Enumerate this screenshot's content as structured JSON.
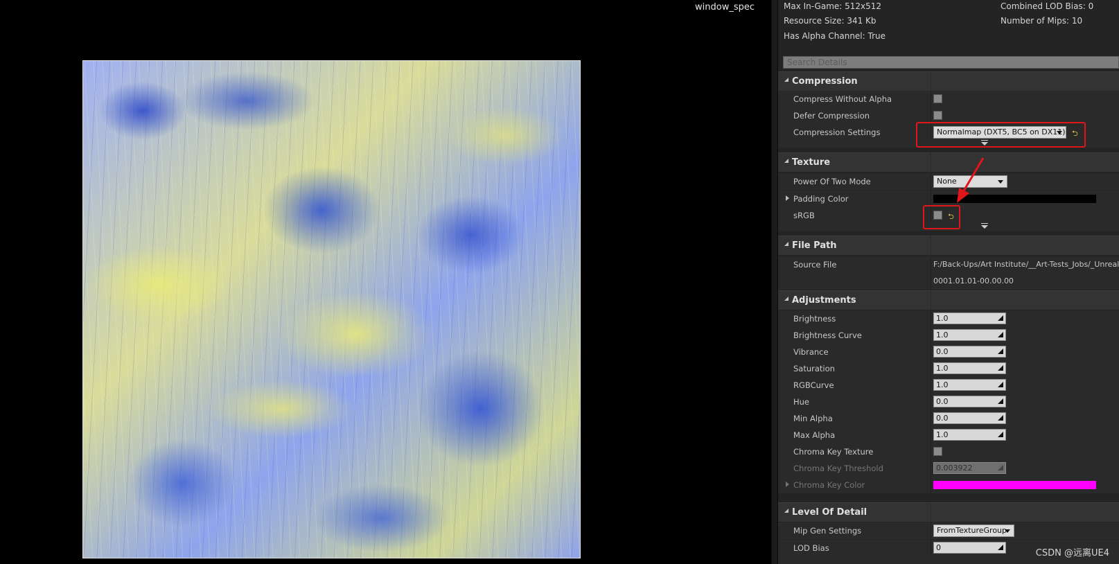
{
  "viewport": {
    "texture_name": "window_spec",
    "colors": {
      "yellow": "#e8e87a",
      "blue": "#3a5ad6"
    }
  },
  "stats": {
    "max_in_game": "Max In-Game: 512x512",
    "resource_size": "Resource Size: 341 Kb",
    "has_alpha": "Has Alpha Channel: True",
    "combined_lod_bias": "Combined LOD Bias: 0",
    "number_of_mips": "Number of Mips: 10"
  },
  "search": {
    "placeholder": "Search Details"
  },
  "compression": {
    "title": "Compression",
    "compress_without_alpha": "Compress Without Alpha",
    "defer_compression": "Defer Compression",
    "compression_settings": "Compression Settings",
    "compression_settings_value": "Normalmap (DXT5, BC5 on DX11)"
  },
  "texture": {
    "title": "Texture",
    "power_of_two_mode": "Power Of Two Mode",
    "power_of_two_value": "None",
    "padding_color": "Padding Color",
    "padding_color_value": "#000000",
    "srgb": "sRGB"
  },
  "file_path": {
    "title": "File Path",
    "source_file": "Source File",
    "source_file_value": "F:/Back-Ups/Art Institute/__Art-Tests_Jobs/_Unreal M",
    "timestamp": "0001.01.01-00.00.00"
  },
  "adjustments": {
    "title": "Adjustments",
    "rows": [
      {
        "label": "Brightness",
        "value": "1.0"
      },
      {
        "label": "Brightness Curve",
        "value": "1.0"
      },
      {
        "label": "Vibrance",
        "value": "0.0"
      },
      {
        "label": "Saturation",
        "value": "1.0"
      },
      {
        "label": "RGBCurve",
        "value": "1.0"
      },
      {
        "label": "Hue",
        "value": "0.0"
      },
      {
        "label": "Min Alpha",
        "value": "0.0"
      },
      {
        "label": "Max Alpha",
        "value": "1.0"
      }
    ],
    "chroma_key_texture": "Chroma Key Texture",
    "chroma_key_threshold": "Chroma Key Threshold",
    "chroma_key_threshold_value": "0.003922",
    "chroma_key_color": "Chroma Key Color",
    "chroma_key_color_value": "#ff00ff"
  },
  "level_of_detail": {
    "title": "Level Of Detail",
    "mip_gen_settings": "Mip Gen Settings",
    "mip_gen_value": "FromTextureGroup",
    "lod_bias": "LOD Bias",
    "lod_bias_value": "0"
  },
  "watermark": "CSDN @远离UE4",
  "annotation_color": "#e0161b"
}
